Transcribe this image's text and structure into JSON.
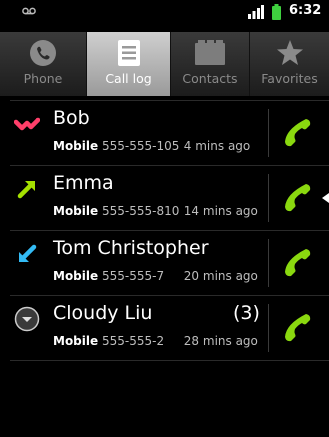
{
  "status_bar": {
    "time": "6:32",
    "icons": [
      "voicemail-icon",
      "signal-icon",
      "battery-icon"
    ],
    "battery_color": "#3fd13f"
  },
  "tabs": [
    {
      "label": "Phone",
      "icon": "phone-icon",
      "selected": false
    },
    {
      "label": "Call log",
      "icon": "call-log-icon",
      "selected": true
    },
    {
      "label": "Contacts",
      "icon": "contacts-icon",
      "selected": false
    },
    {
      "label": "Favorites",
      "icon": "favorites-icon",
      "selected": false
    }
  ],
  "calls": [
    {
      "name": "Bob",
      "count": "",
      "type": "Mobile",
      "number": "555-555-105",
      "time": "4 mins ago",
      "call_kind": "missed",
      "arrow_color": "#ff3f6a"
    },
    {
      "name": "Emma",
      "count": "",
      "type": "Mobile",
      "number": "555-555-810",
      "time": "14 mins ago",
      "call_kind": "outgoing",
      "arrow_color": "#a4e000"
    },
    {
      "name": "Tom Christopher",
      "count": "",
      "type": "Mobile",
      "number": "555-555-7",
      "time": "20 mins ago",
      "call_kind": "incoming",
      "arrow_color": "#33bbf5"
    },
    {
      "name": "Cloudy Liu",
      "count": "(3)",
      "type": "Mobile",
      "number": "555-555-2",
      "time": "28 mins ago",
      "call_kind": "expand",
      "arrow_color": "#cccccc"
    }
  ],
  "call_button_color": "#8ad80f"
}
